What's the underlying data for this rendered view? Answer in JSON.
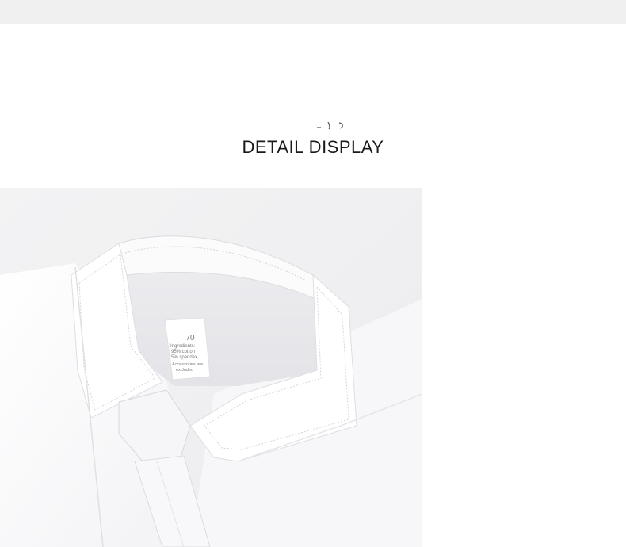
{
  "heading": "DETAIL DISPLAY",
  "label_tag": {
    "size": "70",
    "line1": "Ingredients:",
    "line2": "95% cotton",
    "line3": "5% spandex",
    "line4": "Accessories are",
    "line5": "excluded"
  },
  "colors": {
    "top_band": "#f0f0f0",
    "heading_text": "#1a1a1a",
    "shirt": "#ffffff",
    "shadow": "#e2e2e6"
  }
}
